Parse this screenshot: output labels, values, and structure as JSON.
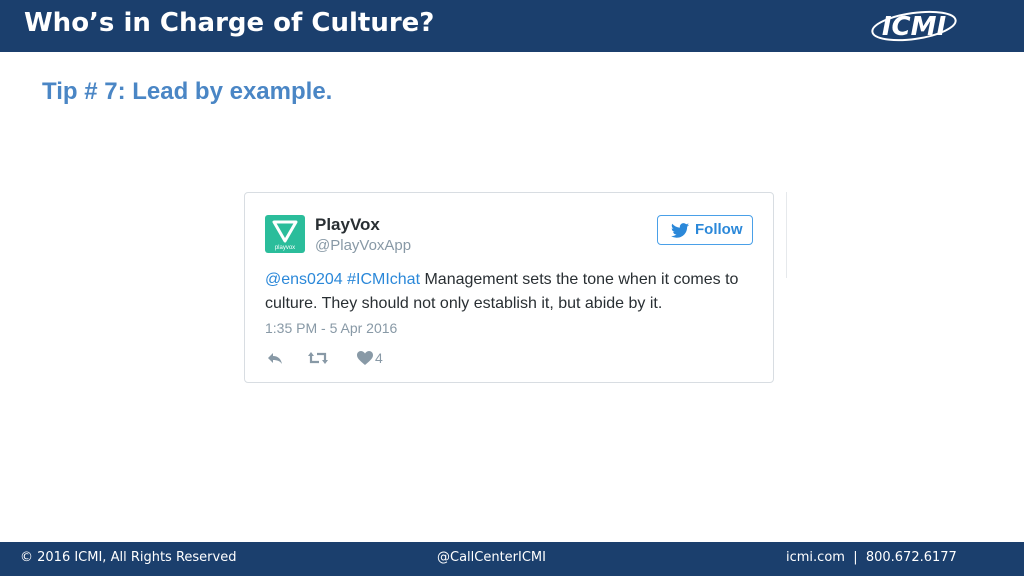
{
  "header": {
    "title": "Who’s in Charge of Culture?",
    "logo_text": "ICMI"
  },
  "slide": {
    "subtitle": "Tip # 7: Lead by example."
  },
  "tweet": {
    "name": "PlayVox",
    "handle": "@PlayVoxApp",
    "follow_label": "Follow",
    "mention": "@ens0204",
    "hashtag": "#ICMIchat",
    "body": " Management sets the tone when it comes to culture. They should not only establish it, but abide by it.",
    "timestamp": "1:35 PM - 5 Apr 2016",
    "likes": "4",
    "avatar_text": "playvox"
  },
  "footer": {
    "copyright": "© 2016 ICMI, All Rights Reserved",
    "twitter": "@CallCenterICMI",
    "contact": "icmi.com  |  800.672.6177"
  },
  "colors": {
    "brand_navy": "#1b3f6d",
    "subtitle_blue": "#4a86c5",
    "twitter_blue": "#2b88d9",
    "avatar_green": "#2bbd9b"
  }
}
